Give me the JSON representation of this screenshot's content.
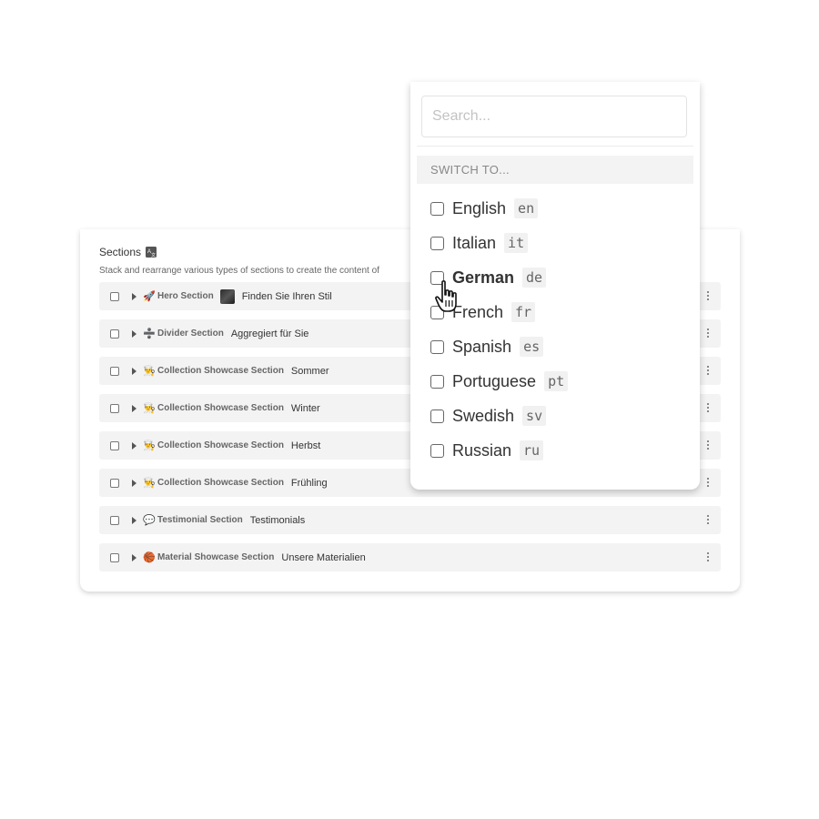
{
  "sections_panel": {
    "title": "Sections",
    "title_icon": "translate-icon",
    "description": "Stack and rearrange various types of sections to create the content of",
    "rows": [
      {
        "emoji": "🚀",
        "icon": "rocket-icon",
        "type": "Hero Section",
        "has_thumb": true,
        "title": "Finden Sie Ihren Stil"
      },
      {
        "emoji": "➗",
        "icon": "divide-icon",
        "type": "Divider Section",
        "has_thumb": false,
        "title": "Aggregiert für Sie"
      },
      {
        "emoji": "👨‍🍳",
        "icon": "person-icon",
        "type": "Collection Showcase Section",
        "has_thumb": false,
        "title": "Sommer"
      },
      {
        "emoji": "👨‍🍳",
        "icon": "person-icon",
        "type": "Collection Showcase Section",
        "has_thumb": false,
        "title": "Winter"
      },
      {
        "emoji": "👨‍🍳",
        "icon": "person-icon",
        "type": "Collection Showcase Section",
        "has_thumb": false,
        "title": "Herbst"
      },
      {
        "emoji": "👨‍🍳",
        "icon": "person-icon",
        "type": "Collection Showcase Section",
        "has_thumb": false,
        "title": "Frühling"
      },
      {
        "emoji": "💬",
        "icon": "speech-bubble-icon",
        "type": "Testimonial Section",
        "has_thumb": false,
        "title": "Testimonials"
      },
      {
        "emoji": "🏀",
        "icon": "ball-icon",
        "type": "Material Showcase Section",
        "has_thumb": false,
        "title": "Unsere Materialien"
      }
    ]
  },
  "language_dropdown": {
    "search_placeholder": "Search...",
    "switch_header": "SWITCH TO...",
    "languages": [
      {
        "name": "English",
        "code": "en",
        "hovered": false
      },
      {
        "name": "Italian",
        "code": "it",
        "hovered": false
      },
      {
        "name": "German",
        "code": "de",
        "hovered": true
      },
      {
        "name": "French",
        "code": "fr",
        "hovered": false
      },
      {
        "name": "Spanish",
        "code": "es",
        "hovered": false
      },
      {
        "name": "Portuguese",
        "code": "pt",
        "hovered": false
      },
      {
        "name": "Swedish",
        "code": "sv",
        "hovered": false
      },
      {
        "name": "Russian",
        "code": "ru",
        "hovered": false
      }
    ]
  },
  "cursor": {
    "icon": "hand-pointer-icon"
  }
}
